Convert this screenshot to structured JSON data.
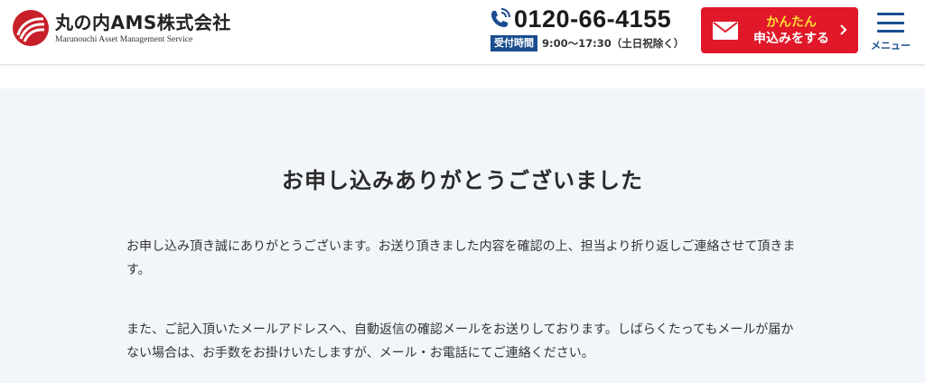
{
  "header": {
    "logo": {
      "name": "丸の内AMS株式会社",
      "subtitle": "Marunouchi Asset Management Service",
      "icon": "logo-circle-mark",
      "brand_color": "#c8202a"
    },
    "contact": {
      "phone_icon": "phone-icon",
      "phone_number": "0120-66-4155",
      "hours_badge": "受付時間",
      "hours_text": "9:00〜17:30（土日祝除く）",
      "badge_color": "#1a4d8f"
    },
    "apply_button": {
      "icon": "mail-icon",
      "line1": "かんたん",
      "line2": "申込みをする",
      "bg_color": "#e0182a",
      "highlight_color": "#ffe033"
    },
    "menu_button": {
      "icon": "hamburger-icon",
      "label": "メニュー"
    }
  },
  "main": {
    "background": "#f2f6fb",
    "title": "お申し込みありがとうございました",
    "paragraphs": [
      "お申し込み頂き誠にありがとうございます。お送り頂きました内容を確認の上、担当より折り返しご連絡させて頂きます。",
      "また、ご記入頂いたメールアドレスへ、自動返信の確認メールをお送りしております。しばらくたってもメールが届かない場合は、お手数をお掛けいたしますが、メール・お電話にてご連絡ください。"
    ]
  }
}
